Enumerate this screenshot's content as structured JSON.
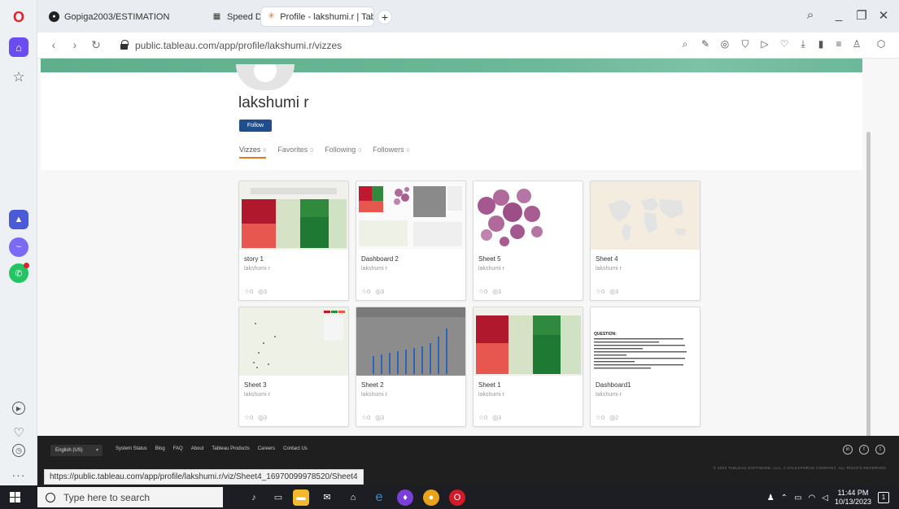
{
  "browser": {
    "tabs": [
      {
        "label": "Gopiga2003/ESTIMATION",
        "icon": "github-icon"
      },
      {
        "label": "Speed Dial",
        "icon": "speed-dial-icon"
      },
      {
        "label": "Profile - lakshumi.r | Table",
        "icon": "tableau-icon"
      }
    ],
    "url": "public.tableau.com/app/profile/lakshumi.r/vizzes",
    "status_url": "https://public.tableau.com/app/profile/lakshumi.r/viz/Sheet4_16970099978520/Sheet4"
  },
  "profile": {
    "name": "lakshumi r",
    "follow_label": "Follow",
    "tabs": [
      {
        "label": "Vizzes",
        "count": "8"
      },
      {
        "label": "Favorites",
        "count": "0"
      },
      {
        "label": "Following",
        "count": "0"
      },
      {
        "label": "Followers",
        "count": "0"
      }
    ]
  },
  "vizzes": [
    {
      "title": "story 1",
      "author": "lakshumi r",
      "favs": "0",
      "views": "3"
    },
    {
      "title": "Dashboard 2",
      "author": "lakshumi r",
      "favs": "0",
      "views": "3"
    },
    {
      "title": "Sheet 5",
      "author": "lakshumi r",
      "favs": "0",
      "views": "3"
    },
    {
      "title": "Sheet 4",
      "author": "lakshumi r",
      "favs": "0",
      "views": "3"
    },
    {
      "title": "Sheet 3",
      "author": "lakshumi r",
      "favs": "0",
      "views": "3"
    },
    {
      "title": "Sheet 2",
      "author": "lakshumi r",
      "favs": "0",
      "views": "3"
    },
    {
      "title": "Sheet 1",
      "author": "lakshumi r",
      "favs": "0",
      "views": "3"
    },
    {
      "title": "Dashboard1",
      "author": "lakshumi r",
      "favs": "0",
      "views": "2"
    }
  ],
  "question_thumb": {
    "heading": "QUESTION:"
  },
  "footer": {
    "language": "English (US)",
    "links": [
      "System Status",
      "Blog",
      "FAQ",
      "About",
      "Tableau Products",
      "Careers",
      "Contact Us"
    ],
    "copyright": "© 2023 TABLEAU SOFTWARE, LLC, A SALESFORCE COMPANY. ALL RIGHTS RESERVED"
  },
  "taskbar": {
    "search_placeholder": "Type here to search",
    "time": "11:44 PM",
    "date": "10/13/2023",
    "notification_count": "1"
  }
}
